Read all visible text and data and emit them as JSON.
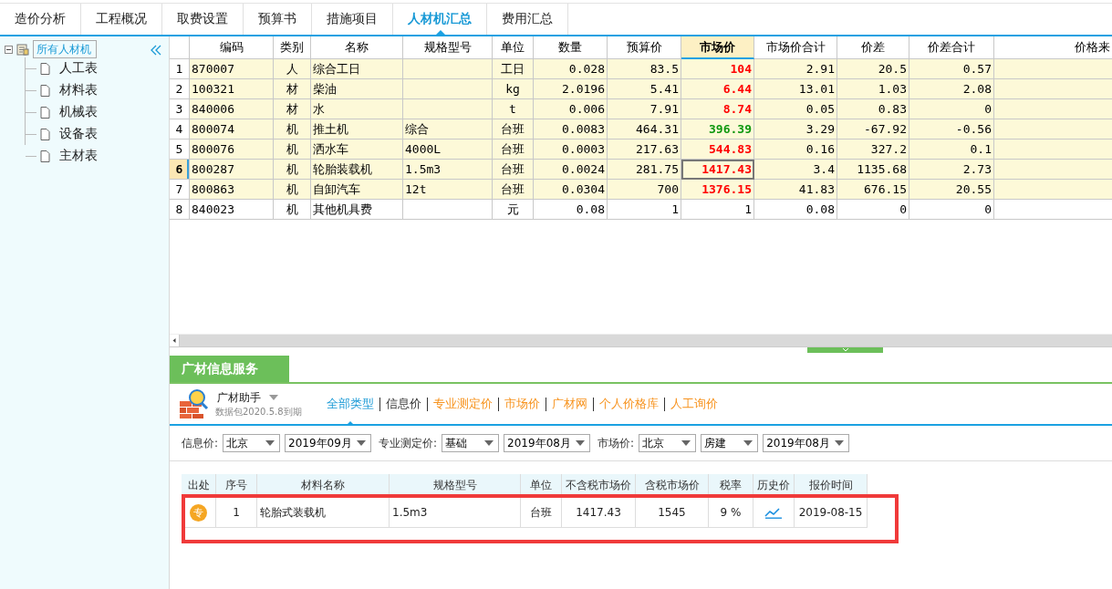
{
  "tabs": [
    {
      "label": "造价分析",
      "selected": false
    },
    {
      "label": "工程概况",
      "selected": false
    },
    {
      "label": "取费设置",
      "selected": false
    },
    {
      "label": "预算书",
      "selected": false
    },
    {
      "label": "措施项目",
      "selected": false
    },
    {
      "label": "人材机汇总",
      "selected": true
    },
    {
      "label": "费用汇总",
      "selected": false
    }
  ],
  "tree": {
    "label": "所有人材机",
    "expanded": true,
    "selected": true,
    "children": [
      {
        "label": "人工表",
        "selected": false
      },
      {
        "label": "材料表",
        "selected": false
      },
      {
        "label": "机械表",
        "selected": false
      },
      {
        "label": "设备表",
        "selected": false
      },
      {
        "label": "主材表",
        "selected": false
      }
    ]
  },
  "grid": {
    "columns": [
      {
        "label": "编码",
        "selected": false
      },
      {
        "label": "类别",
        "selected": false
      },
      {
        "label": "名称",
        "selected": false
      },
      {
        "label": "规格型号",
        "selected": false
      },
      {
        "label": "单位",
        "selected": false
      },
      {
        "label": "数量",
        "selected": false
      },
      {
        "label": "预算价",
        "selected": false
      },
      {
        "label": "市场价",
        "selected": true
      },
      {
        "label": "市场价合计",
        "selected": false
      },
      {
        "label": "价差",
        "selected": false
      },
      {
        "label": "价差合计",
        "selected": false
      },
      {
        "label": "价格来",
        "selected": false
      }
    ],
    "rows": [
      {
        "index": "1",
        "code": "870007",
        "type": "人",
        "name": "综合工日",
        "spec": "",
        "unit": "工日",
        "qty": "0.028",
        "budget": "83.5",
        "market": "104",
        "color": "#ff0000",
        "market_bold": true,
        "market_total": "2.91",
        "diff": "20.5",
        "diff_total": "0.57",
        "highlighted": true,
        "selected": false
      },
      {
        "index": "2",
        "code": "100321",
        "type": "材",
        "name": "柴油",
        "spec": "",
        "unit": "kg",
        "qty": "2.0196",
        "budget": "5.41",
        "market": "6.44",
        "color": "#ff0000",
        "market_bold": true,
        "market_total": "13.01",
        "diff": "1.03",
        "diff_total": "2.08",
        "highlighted": true,
        "selected": false
      },
      {
        "index": "3",
        "code": "840006",
        "type": "材",
        "name": "水",
        "spec": "",
        "unit": "t",
        "qty": "0.006",
        "budget": "7.91",
        "market": "8.74",
        "color": "#ff0000",
        "market_bold": true,
        "market_total": "0.05",
        "diff": "0.83",
        "diff_total": "0",
        "highlighted": true,
        "selected": false
      },
      {
        "index": "4",
        "code": "800074",
        "type": "机",
        "name": "推土机",
        "spec": "综合",
        "unit": "台班",
        "qty": "0.0083",
        "budget": "464.31",
        "market": "396.39",
        "color": "#119911",
        "market_bold": true,
        "market_total": "3.29",
        "diff": "-67.92",
        "diff_total": "-0.56",
        "highlighted": true,
        "selected": false
      },
      {
        "index": "5",
        "code": "800076",
        "type": "机",
        "name": "洒水车",
        "spec": "4000L",
        "unit": "台班",
        "qty": "0.0003",
        "budget": "217.63",
        "market": "544.83",
        "color": "#ff0000",
        "market_bold": true,
        "market_total": "0.16",
        "diff": "327.2",
        "diff_total": "0.1",
        "highlighted": true,
        "selected": false
      },
      {
        "index": "6",
        "code": "800287",
        "type": "机",
        "name": "轮胎装载机",
        "spec": "1.5m3",
        "unit": "台班",
        "qty": "0.0024",
        "budget": "281.75",
        "market": "1417.43",
        "color": "#ff0000",
        "market_bold": true,
        "market_total": "3.4",
        "diff": "1135.68",
        "diff_total": "2.73",
        "highlighted": true,
        "selected": true
      },
      {
        "index": "7",
        "code": "800863",
        "type": "机",
        "name": "自卸汽车",
        "spec": "12t",
        "unit": "台班",
        "qty": "0.0304",
        "budget": "700",
        "market": "1376.15",
        "color": "#ff0000",
        "market_bold": true,
        "market_total": "41.83",
        "diff": "676.15",
        "diff_total": "20.55",
        "highlighted": true,
        "selected": false
      },
      {
        "index": "8",
        "code": "840023",
        "type": "机",
        "name": "其他机具费",
        "spec": "",
        "unit": "元",
        "qty": "0.08",
        "budget": "1",
        "market": "1",
        "color": "#000000",
        "market_bold": false,
        "market_total": "0.08",
        "diff": "0",
        "diff_total": "0",
        "highlighted": false,
        "selected": false
      }
    ]
  },
  "service": {
    "title": "广材信息服务",
    "assistant": "广材助手",
    "package_note": "数据包2020.5.8到期",
    "links": [
      {
        "label": "全部类型",
        "selected": true
      },
      {
        "label": "信息价",
        "selected": false,
        "color": "#333333"
      },
      {
        "label": "专业测定价",
        "selected": false,
        "color": "#f7931e"
      },
      {
        "label": "市场价",
        "selected": false,
        "color": "#f7931e"
      },
      {
        "label": "广材网",
        "selected": false,
        "color": "#f7931e"
      },
      {
        "label": "个人价格库",
        "selected": false,
        "color": "#f7931e"
      },
      {
        "label": "人工询价",
        "selected": false,
        "color": "#f7931e"
      }
    ],
    "filters": [
      {
        "label": "信息价:",
        "selects": [
          {
            "value": "北京",
            "kind": "short"
          },
          {
            "value": "2019年09月",
            "kind": "long"
          }
        ]
      },
      {
        "label": "专业测定价:",
        "selects": [
          {
            "value": "基础",
            "kind": "short"
          },
          {
            "value": "2019年08月",
            "kind": "long"
          }
        ]
      },
      {
        "label": "市场价:",
        "selects": [
          {
            "value": "北京",
            "kind": "short"
          },
          {
            "value": "房建",
            "kind": "short"
          },
          {
            "value": "2019年08月",
            "kind": "long"
          }
        ]
      }
    ],
    "table": {
      "columns": [
        "出处",
        "序号",
        "材料名称",
        "规格型号",
        "单位",
        "不含税市场价",
        "含税市场价",
        "税率",
        "历史价",
        "报价时间"
      ],
      "rows": [
        {
          "source_badge": "专",
          "index": "1",
          "name": "轮胎式装载机",
          "spec": "1.5m3",
          "unit": "台班",
          "price_ex_tax": "1417.43",
          "price_inc_tax": "1545",
          "tax_rate": "9 %",
          "date": "2019-08-15",
          "highlighted": true
        }
      ]
    }
  }
}
